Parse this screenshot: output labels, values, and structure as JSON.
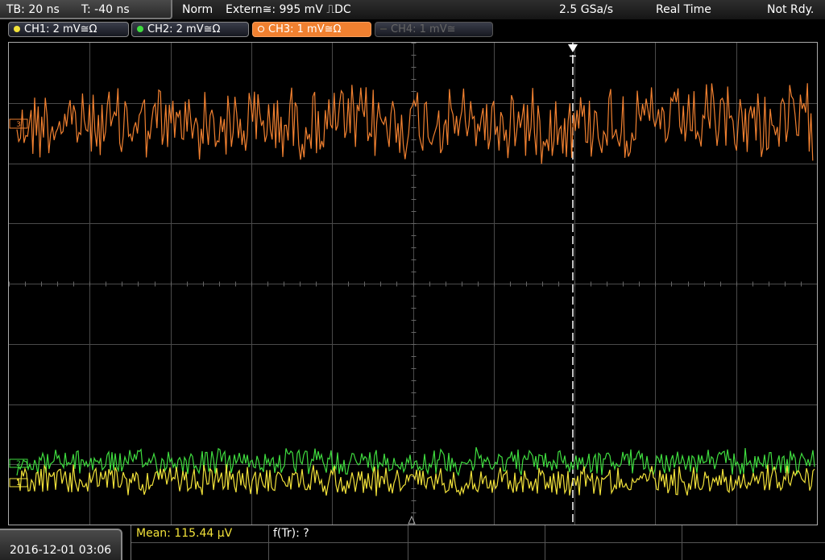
{
  "topbar": {
    "timebase": "TB: 20 ns",
    "trigger_time": "T: -40 ns",
    "mode": "Norm",
    "source": "Extern≅: 995 mV ⎍DC",
    "sample_rate": "2.5 GSa/s",
    "acq_mode": "Real Time",
    "status": "Not Rdy."
  },
  "channels": [
    {
      "label": "CH1: 2 mV≅Ω",
      "color": "#f2e23a"
    },
    {
      "label": "CH2: 2 mV≅Ω",
      "color": "#3fdc3f"
    },
    {
      "label": "CH3: 1 mV≅Ω",
      "color": "#f08030"
    },
    {
      "label": "CH4: 1 mV≅",
      "color": "#555555"
    }
  ],
  "markers": {
    "ch3": "3",
    "ch2": "2",
    "ch1": "1",
    "trigger": "T"
  },
  "date": "2016-12-01 03:06",
  "measurements": {
    "mean": "Mean: 115.44 µV",
    "freq": "f(Tr): ?"
  },
  "colors": {
    "grid": "#555555",
    "trigger_line": "#ffffff"
  }
}
